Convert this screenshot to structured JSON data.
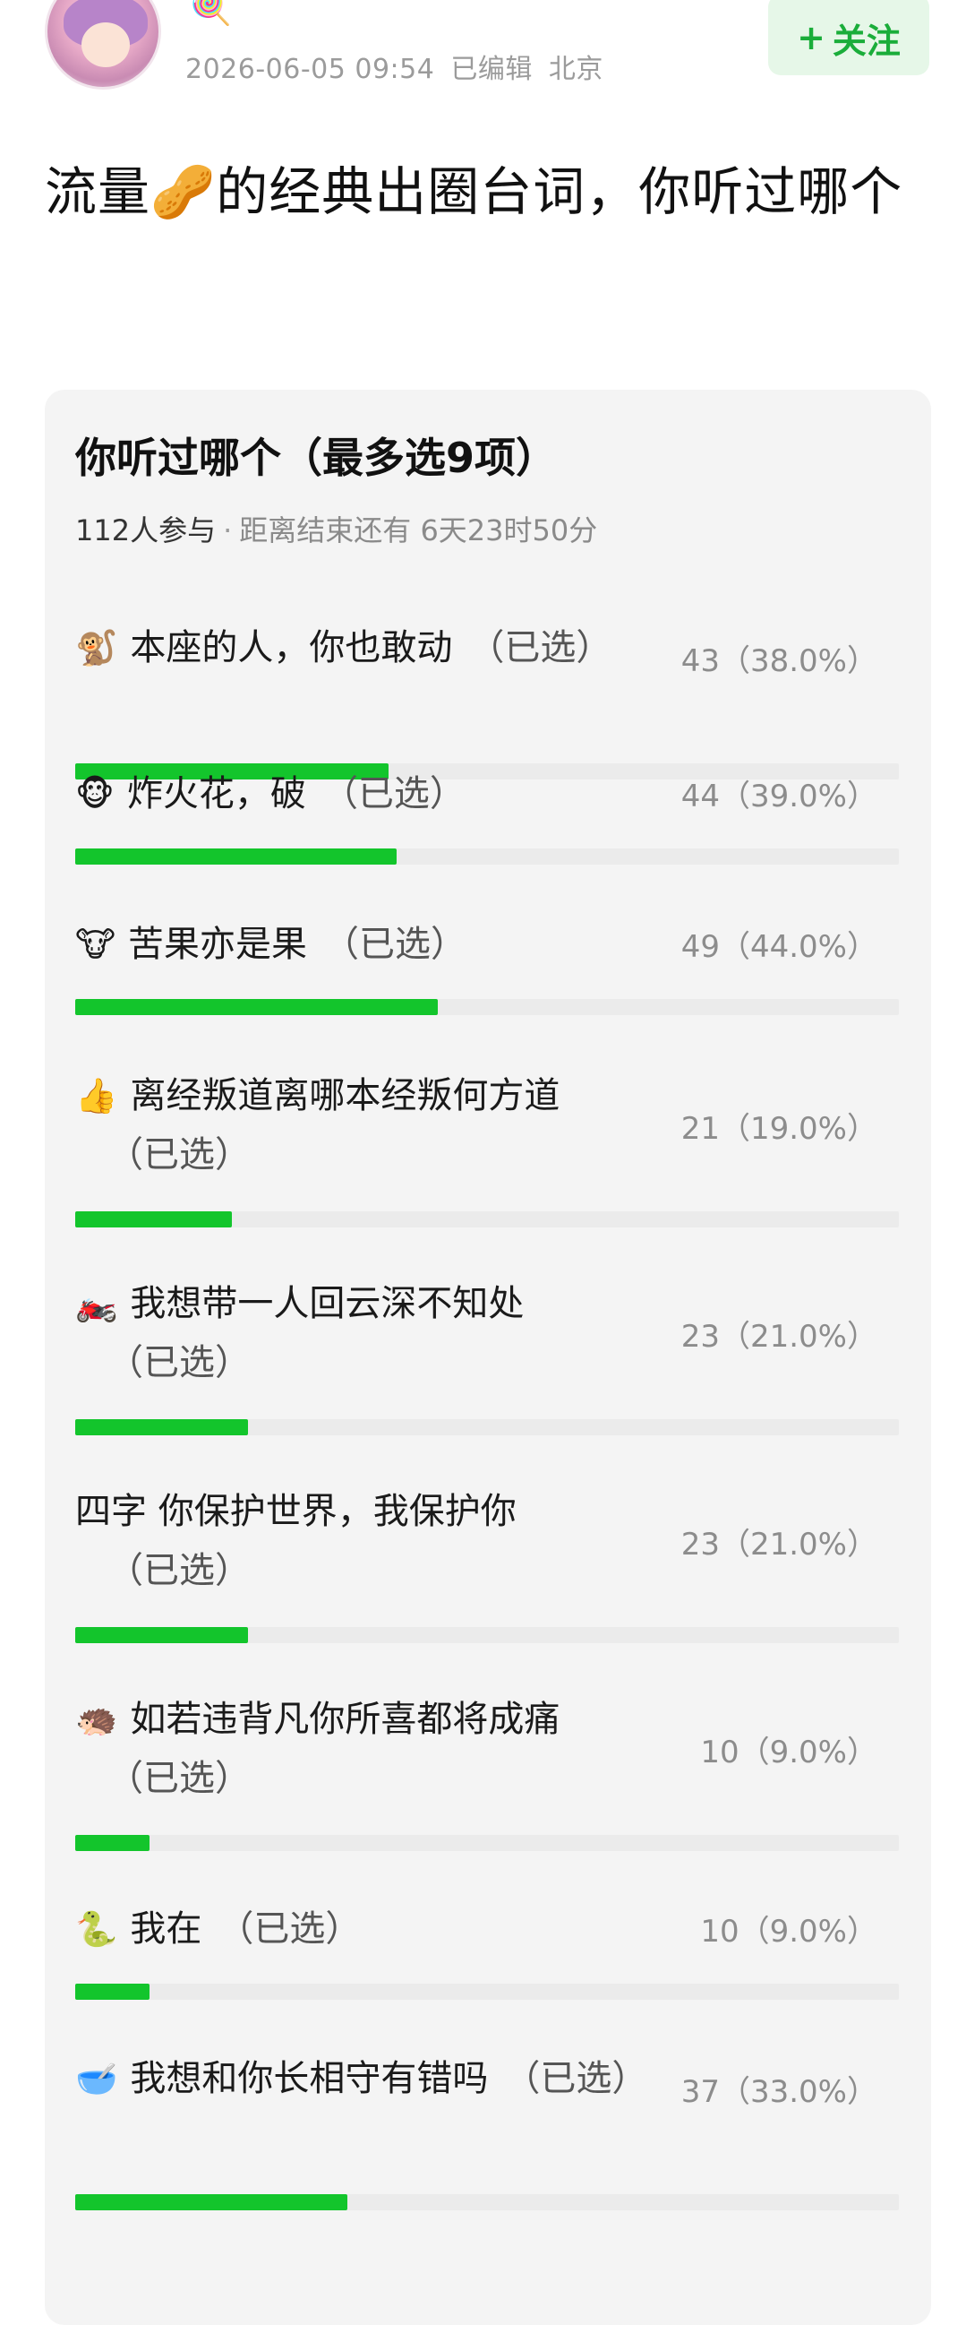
{
  "header": {
    "avatar_alt": "user avatar",
    "badge_icon": "🍭",
    "timestamp": "2026-06-05 09:54",
    "edited": "已编辑",
    "location": "北京",
    "follow_plus": "+",
    "follow_label": "关注"
  },
  "post": {
    "title_part1": "流量",
    "title_emoji": "🥜",
    "title_part2": "的经典出圈台词，你听过哪个"
  },
  "poll": {
    "title": "你听过哪个（最多选9项）",
    "participants": "112人参与",
    "separator": "·",
    "countdown": "距离结束还有 6天23时50分",
    "options": [
      {
        "emoji": "🐒",
        "text": "本座的人，你也敢动",
        "selected": "（已选）",
        "count": "43",
        "percent": "（38.0%）",
        "fraction": 0.38
      },
      {
        "emoji": "🐵",
        "text": "炸火花，破",
        "selected": "（已选）",
        "count": "44",
        "percent": "（39.0%）",
        "fraction": 0.39
      },
      {
        "emoji": "🐮",
        "text": "苦果亦是果",
        "selected": "（已选）",
        "count": "49",
        "percent": "（44.0%）",
        "fraction": 0.44
      },
      {
        "emoji": "👍",
        "text": "离经叛道离哪本经叛何方道",
        "selected": "（已选）",
        "count": "21",
        "percent": "（19.0%）",
        "fraction": 0.19
      },
      {
        "emoji": "🏍️",
        "text": "我想带一人回云深不知处",
        "selected": "（已选）",
        "count": "23",
        "percent": "（21.0%）",
        "fraction": 0.21
      },
      {
        "emoji": "",
        "text": "四字 你保护世界，我保护你",
        "selected": "（已选）",
        "count": "23",
        "percent": "（21.0%）",
        "fraction": 0.21
      },
      {
        "emoji": "🦔",
        "text": "如若违背凡你所喜都将成痛",
        "selected": "（已选）",
        "count": "10",
        "percent": "（9.0%）",
        "fraction": 0.09
      },
      {
        "emoji": "🐍",
        "text": "我在",
        "selected": "（已选）",
        "count": "10",
        "percent": "（9.0%）",
        "fraction": 0.09
      },
      {
        "emoji": "🥣",
        "text": "我想和你长相守有错吗",
        "selected": "（已选）",
        "count": "37",
        "percent": "（33.0%）",
        "fraction": 0.33
      }
    ]
  },
  "colors": {
    "accent_green": "#13c52c",
    "follow_bg": "#e6f7e8",
    "follow_text": "#1aad3a",
    "card_bg": "#f4f4f4",
    "track": "#ebebeb"
  }
}
